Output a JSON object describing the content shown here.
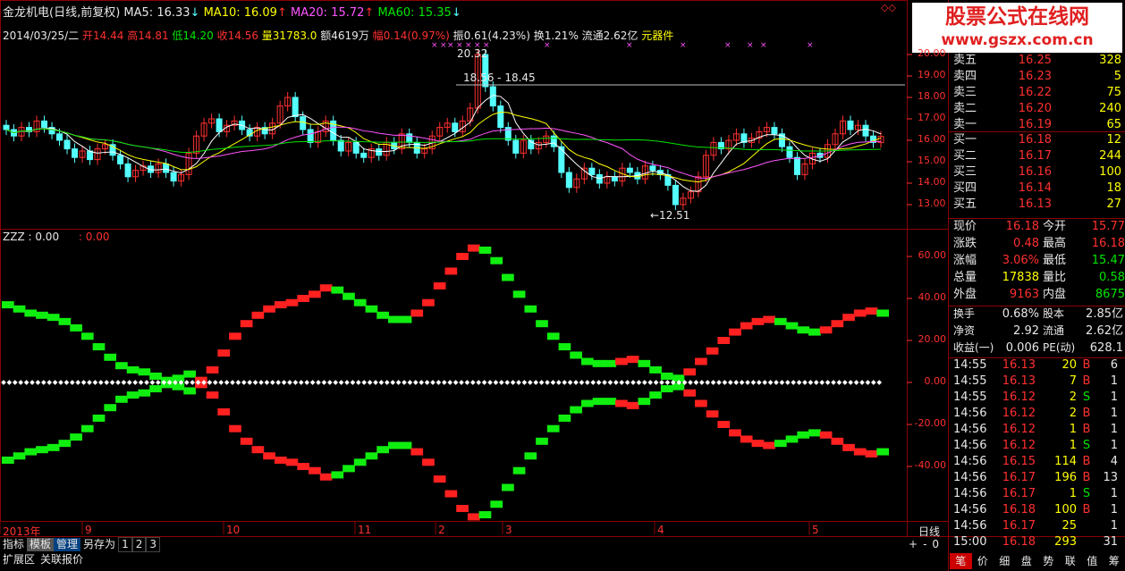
{
  "header": {
    "title": "金龙机电(日线,前复权)",
    "ma5": "MA5: 16.33",
    "ma10": "MA10: 16.09",
    "ma20": "MA20: 15.72",
    "ma60": "MA60: 15.35"
  },
  "info_line": {
    "date": "2014/03/25/二",
    "open": "开14.44",
    "high": "高14.81",
    "low": "低14.20",
    "close": "收14.56",
    "volume": "量31783.0",
    "amount": "额4619万",
    "change": "幅0.14(0.97%)",
    "amplitude": "振0.61(4.23%)",
    "turnover": "换1.21%",
    "float": "流通2.62亿",
    "link": "元器件"
  },
  "watermark": {
    "line1": "股票公式在线网",
    "line2": "www.gszx.com.cn"
  },
  "annotations": {
    "high": "20.32",
    "range": "18.56 - 18.45",
    "low": "←12.51"
  },
  "price_axis": [
    "20.00",
    "19.00",
    "18.00",
    "17.00",
    "16.00",
    "15.00",
    "14.00",
    "13.00"
  ],
  "indicator": {
    "name": "ZZZ",
    "val1": ": 0.00",
    "val2": ": 0.00"
  },
  "indicator_axis": [
    "60.00",
    "40.00",
    "20.00",
    "0.00",
    "-20.00",
    "-40.00"
  ],
  "time_axis": {
    "labels": [
      "2013年",
      "9",
      "10",
      "11",
      "2",
      "3",
      "4",
      "5"
    ],
    "period": "日线"
  },
  "bottom_bar": {
    "buttons": [
      "指标",
      "模板",
      "管理",
      "另存为",
      "1",
      "2",
      "3"
    ],
    "row2": [
      "扩展区",
      "关联报价"
    ],
    "right_buttons": [
      "+",
      "-",
      "0"
    ],
    "tabs": [
      "笔",
      "价",
      "细",
      "盘",
      "势",
      "联",
      "值",
      "筹"
    ]
  },
  "orderbook": {
    "asks": [
      {
        "label": "卖五",
        "price": "16.25",
        "vol": "328"
      },
      {
        "label": "卖四",
        "price": "16.23",
        "vol": "5"
      },
      {
        "label": "卖三",
        "price": "16.22",
        "vol": "75"
      },
      {
        "label": "卖二",
        "price": "16.20",
        "vol": "240"
      },
      {
        "label": "卖一",
        "price": "16.19",
        "vol": "65"
      }
    ],
    "bids": [
      {
        "label": "买一",
        "price": "16.18",
        "vol": "12"
      },
      {
        "label": "买二",
        "price": "16.17",
        "vol": "244"
      },
      {
        "label": "买三",
        "price": "16.16",
        "vol": "100"
      },
      {
        "label": "买四",
        "price": "16.14",
        "vol": "18"
      },
      {
        "label": "买五",
        "price": "16.13",
        "vol": "27"
      }
    ]
  },
  "quote": {
    "rows": [
      {
        "l1": "现价",
        "v1": "16.18",
        "c1": "#ff3030",
        "l2": "今开",
        "v2": "15.77",
        "c2": "#ff3030"
      },
      {
        "l1": "涨跌",
        "v1": "0.48",
        "c1": "#ff3030",
        "l2": "最高",
        "v2": "16.18",
        "c2": "#ff3030"
      },
      {
        "l1": "涨幅",
        "v1": "3.06%",
        "c1": "#ff3030",
        "l2": "最低",
        "v2": "15.47",
        "c2": "#00e600"
      },
      {
        "l1": "总量",
        "v1": "17838",
        "c1": "#ffff00",
        "l2": "量比",
        "v2": "0.58",
        "c2": "#00e600"
      },
      {
        "l1": "外盘",
        "v1": "9163",
        "c1": "#ff3030",
        "l2": "内盘",
        "v2": "8675",
        "c2": "#00e600"
      }
    ],
    "fund": [
      {
        "l1": "换手",
        "v1": "0.68%",
        "l2": "股本",
        "v2": "2.85亿"
      },
      {
        "l1": "净资",
        "v1": "2.92",
        "l2": "流通",
        "v2": "2.62亿"
      },
      {
        "l1": "收益(一)",
        "v1": "0.006",
        "l2": "PE(动)",
        "v2": "628.1"
      }
    ]
  },
  "ticks": [
    {
      "time": "14:55",
      "price": "16.13",
      "vol": "20",
      "bs": "B",
      "n": "6"
    },
    {
      "time": "14:55",
      "price": "16.13",
      "vol": "7",
      "bs": "B",
      "n": "1"
    },
    {
      "time": "14:55",
      "price": "16.12",
      "vol": "2",
      "bs": "S",
      "n": "1"
    },
    {
      "time": "14:56",
      "price": "16.12",
      "vol": "2",
      "bs": "B",
      "n": "1"
    },
    {
      "time": "14:56",
      "price": "16.12",
      "vol": "1",
      "bs": "B",
      "n": "1"
    },
    {
      "time": "14:56",
      "price": "16.12",
      "vol": "1",
      "bs": "S",
      "n": "1"
    },
    {
      "time": "14:56",
      "price": "16.15",
      "vol": "114",
      "bs": "B",
      "n": "4"
    },
    {
      "time": "14:56",
      "price": "16.17",
      "vol": "196",
      "bs": "B",
      "n": "13"
    },
    {
      "time": "14:56",
      "price": "16.17",
      "vol": "1",
      "bs": "S",
      "n": "1"
    },
    {
      "time": "14:56",
      "price": "16.18",
      "vol": "100",
      "bs": "B",
      "n": "1"
    },
    {
      "time": "14:56",
      "price": "16.17",
      "vol": "25",
      "bs": "",
      "n": "1"
    },
    {
      "time": "15:00",
      "price": "16.18",
      "vol": "293",
      "bs": "",
      "n": "31"
    }
  ],
  "colors": {
    "up": "#ff3030",
    "down": "#54ffff",
    "grid": "#8b0000",
    "ma5": "#ffffff",
    "ma10": "#ffff00",
    "ma20": "#ff55ff",
    "ma60": "#00e600"
  }
}
